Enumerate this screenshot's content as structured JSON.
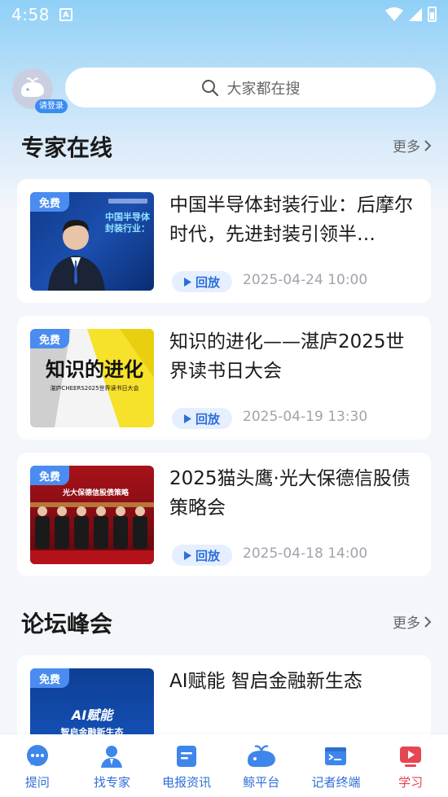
{
  "status_bar": {
    "time": "4:58",
    "notif_glyph": "A"
  },
  "header": {
    "login_label": "请登录",
    "search_placeholder": "大家都在搜"
  },
  "sections": [
    {
      "title": "专家在线",
      "more": "更多"
    },
    {
      "title": "论坛峰会",
      "more": "更多"
    }
  ],
  "expert_cards": [
    {
      "badge": "免费",
      "title": "中国半导体封装行业：后摩尔时代，先进封装引领半…",
      "replay": "回放",
      "date": "2025-04-24 10:00",
      "thumb_text": [
        "中国半导体",
        "封装行业："
      ]
    },
    {
      "badge": "免费",
      "title": "知识的进化——湛庐2025世界读书日大会",
      "replay": "回放",
      "date": "2025-04-19 13:30",
      "thumb_text": [
        "知识的进化",
        "湛庐CHEERS2025世界读书日大会"
      ]
    },
    {
      "badge": "免费",
      "title": "2025猫头鹰·光大保德信股债策略会",
      "replay": "回放",
      "date": "2025-04-18 14:00",
      "thumb_text": [
        "光大保德信股债策略"
      ]
    }
  ],
  "forum_cards": [
    {
      "badge": "免费",
      "title": "AI赋能 智启金融新生态",
      "thumb_text": [
        "AI赋能",
        "智启金融新生态"
      ]
    }
  ],
  "bottom_nav": [
    {
      "label": "提问",
      "icon": "chat-bubble-icon",
      "active": false
    },
    {
      "label": "找专家",
      "icon": "person-icon",
      "active": false
    },
    {
      "label": "电报资讯",
      "icon": "document-icon",
      "active": false
    },
    {
      "label": "鲸平台",
      "icon": "whale-icon",
      "active": false
    },
    {
      "label": "记者终端",
      "icon": "terminal-icon",
      "active": false
    },
    {
      "label": "学习",
      "icon": "play-icon",
      "active": true
    }
  ],
  "colors": {
    "accent": "#3b8cf2",
    "nav_blue": "#2f6fd8",
    "nav_active": "#e64553",
    "replay_bg": "#e6efff"
  }
}
